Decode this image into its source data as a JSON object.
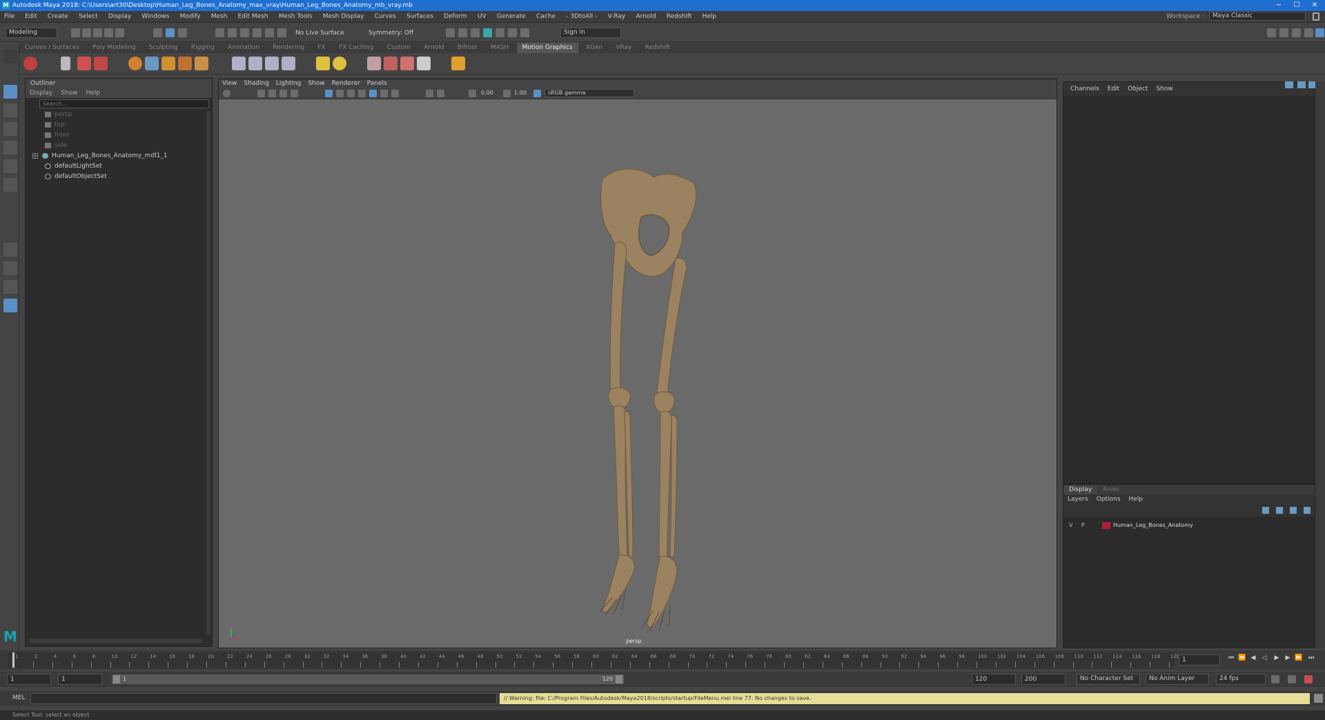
{
  "titlebar": {
    "title": "Autodesk Maya 2018: C:\\Users\\art30\\Desktop\\Human_Leg_Bones_Anatomy_max_vray\\Human_Leg_Bones_Anatomy_mb_vray.mb",
    "minimize": "−",
    "maximize": "☐",
    "close": "✕"
  },
  "menubar": {
    "items": [
      "File",
      "Edit",
      "Create",
      "Select",
      "Display",
      "Windows",
      "Modify",
      "Mesh",
      "Edit Mesh",
      "Mesh Tools",
      "Mesh Display",
      "Curves",
      "Surfaces",
      "Deform",
      "UV",
      "Generate",
      "Cache",
      "- 3DtoAll -",
      "V-Ray",
      "Arnold",
      "Redshift",
      "Help"
    ]
  },
  "workspace": {
    "label": "Workspace :",
    "value": "Maya Classic"
  },
  "statusline": {
    "mode": "Modeling",
    "live_surface": "No Live Surface",
    "symmetry": "Symmetry: Off",
    "sign_in": "Sign In"
  },
  "shelf": {
    "tabs": [
      "Curves / Surfaces",
      "Poly Modeling",
      "Sculpting",
      "Rigging",
      "Animation",
      "Rendering",
      "FX",
      "FX Caching",
      "Custom",
      "Arnold",
      "Bifrost",
      "MASH",
      "Motion Graphics",
      "XGen",
      "VRay",
      "Redshift"
    ],
    "active_tab": "Motion Graphics"
  },
  "outliner": {
    "title": "Outliner",
    "menus": [
      "Display",
      "Show",
      "Help"
    ],
    "search_placeholder": "Search...",
    "items": [
      {
        "label": "persp",
        "type": "camera"
      },
      {
        "label": "top",
        "type": "camera"
      },
      {
        "label": "front",
        "type": "camera"
      },
      {
        "label": "side",
        "type": "camera"
      },
      {
        "label": "Human_Leg_Bones_Anatomy_mdl1_1",
        "type": "group"
      },
      {
        "label": "defaultLightSet",
        "type": "set"
      },
      {
        "label": "defaultObjectSet",
        "type": "set"
      }
    ]
  },
  "viewport": {
    "menus": [
      "View",
      "Shading",
      "Lighting",
      "Show",
      "Renderer",
      "Panels"
    ],
    "exposure": "0.00",
    "gamma": "1.00",
    "color_space": "sRGB gamma",
    "camera_label": "persp"
  },
  "channelbox": {
    "menus": [
      "Channels",
      "Edit",
      "Object",
      "Show"
    ]
  },
  "layer_editor": {
    "tabs": [
      "Display",
      "Anim"
    ],
    "menus": [
      "Layers",
      "Options",
      "Help"
    ],
    "layers": [
      {
        "v": "V",
        "p": "P",
        "name": "Human_Leg_Bones_Anatomy",
        "color": "#b0203a"
      }
    ]
  },
  "timeline": {
    "ticks": [
      "1",
      "2",
      "4",
      "6",
      "8",
      "10",
      "12",
      "14",
      "16",
      "18",
      "20",
      "22",
      "24",
      "26",
      "28",
      "30",
      "32",
      "34",
      "36",
      "38",
      "40",
      "42",
      "44",
      "46",
      "48",
      "50",
      "52",
      "54",
      "56",
      "58",
      "60",
      "62",
      "64",
      "66",
      "68",
      "70",
      "72",
      "74",
      "76",
      "78",
      "80",
      "82",
      "84",
      "86",
      "88",
      "90",
      "92",
      "94",
      "96",
      "98",
      "100",
      "102",
      "104",
      "106",
      "108",
      "110",
      "112",
      "114",
      "116",
      "118",
      "120"
    ],
    "current_frame": "1"
  },
  "range": {
    "start": "1",
    "playback_start": "1",
    "slider_start": "1",
    "slider_end": "120",
    "playback_end": "120",
    "end": "200",
    "character_set": "No Character Set",
    "anim_layer": "No Anim Layer",
    "fps": "24 fps"
  },
  "cmdline": {
    "label": "MEL",
    "warning": "// Warning: file: C:/Program Files/Autodesk/Maya2018/scripts/startup/FileMenu.mel line 77: No changes to save."
  },
  "helpline": {
    "text": "Select Tool: select an object"
  },
  "colors": {
    "accent": "#1e6fd0",
    "bone": "#9b8260",
    "warning_bg": "#e6dd98"
  }
}
